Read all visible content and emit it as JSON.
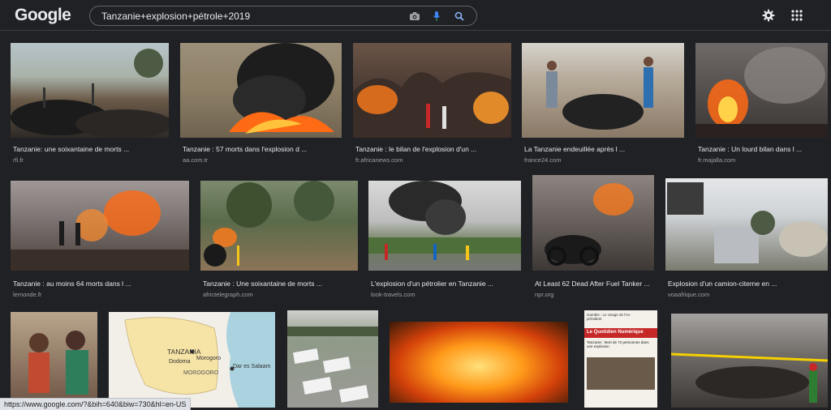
{
  "header": {
    "logo": "Google",
    "search": {
      "value": "Tanzanie+explosion+pétrole+2019"
    },
    "icons": [
      "camera-icon",
      "microphone-icon",
      "search-icon",
      "settings-gear-icon",
      "apps-grid-icon"
    ]
  },
  "results": [
    {
      "caption": "Tanzanie: une soixantaine de morts ...",
      "source": "rfi.fr"
    },
    {
      "caption": "Tanzanie : 57 morts dans l'explosion d ...",
      "source": "aa.com.tr"
    },
    {
      "caption": "Tanzanie : le bilan de l'explosion d'un ...",
      "source": "fr.africanews.com"
    },
    {
      "caption": "La Tanzanie endeuillée après l ...",
      "source": "france24.com"
    },
    {
      "caption": "Tanzanie : Un lourd bilan dans l ...",
      "source": "fr.majalla.com"
    },
    {
      "caption": "Tanzanie : au moins 64 morts dans l ...",
      "source": "lemonde.fr"
    },
    {
      "caption": "Tanzanie : Une soixantaine de morts ...",
      "source": "africtelegraph.com"
    },
    {
      "caption": "L'explosion d'un pétrolier en Tanzanie ...",
      "source": "look-travels.com"
    },
    {
      "caption": "At Least 62 Dead After Fuel Tanker ...",
      "source": "npr.org"
    },
    {
      "caption": "Explosion d'un camion-citerne en ...",
      "source": "voaafrique.com"
    },
    {
      "caption": "",
      "source": ""
    },
    {
      "caption": "",
      "source": "",
      "map": {
        "country": "TANZANIA",
        "cities": [
          "Dodoma",
          "Morogoro",
          "Dar es Salaam",
          "MOROGORO"
        ]
      }
    },
    {
      "caption": "",
      "source": ""
    },
    {
      "caption": "",
      "source": ""
    },
    {
      "caption": "",
      "source": "",
      "newspaper": {
        "masthead": "Le Quotidien Numérique",
        "headline": "Tanzanie : Mort de 72 personnes dans une explosion",
        "top": "Gambie : Le visage de l'ex-président"
      }
    },
    {
      "caption": "",
      "source": ""
    }
  ],
  "status": {
    "url": "https://www.google.com/?&bih=640&biw=730&hl=en-US"
  },
  "colors": {
    "background": "#202124",
    "text": "#e8eaed",
    "muted": "#9aa0a6",
    "fire": "#ff7a1a",
    "smoke": "#2b2b2b"
  }
}
